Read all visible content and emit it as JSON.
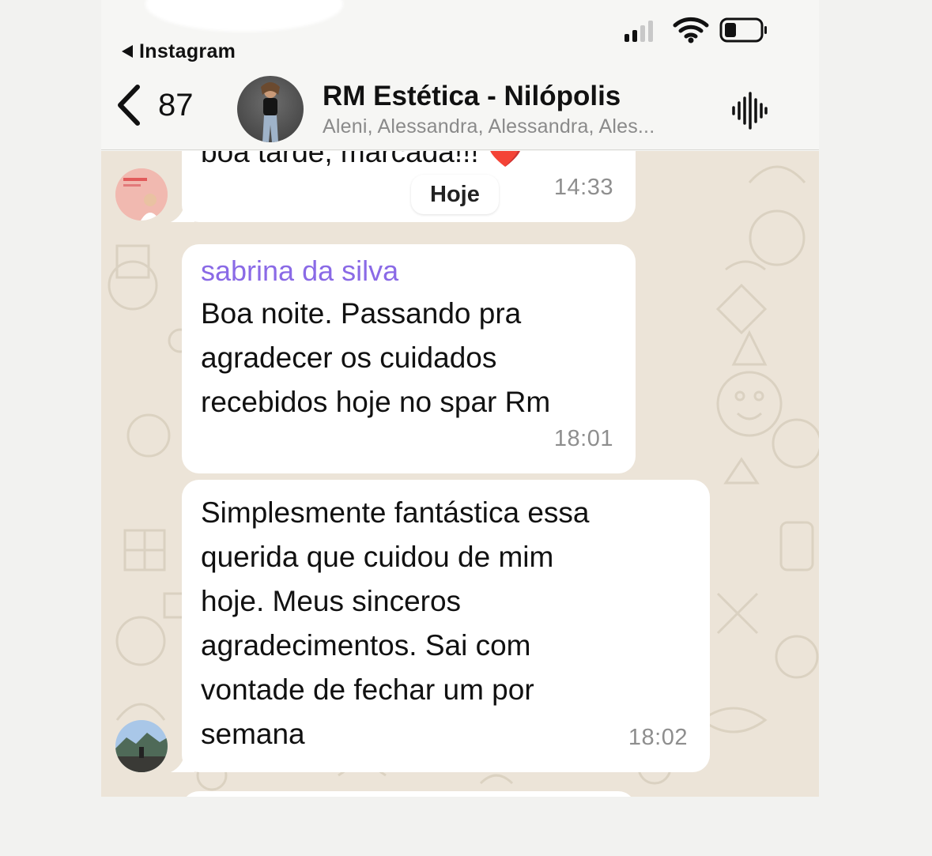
{
  "status_bar": {
    "back_app": "Instagram"
  },
  "header": {
    "unread_count": "87",
    "title": "RM Estética - Nilópolis",
    "subtitle": "Aleni, Alessandra, Alessandra, Ales..."
  },
  "messages": [
    {
      "partial_text": "boa tarde, marcada!!! ",
      "emoji": "❤️",
      "date_pill": "Hoje",
      "time": "14:33"
    },
    {
      "sender": "sabrina da silva",
      "text": "Boa noite. Passando pra\nagradecer os cuidados\nrecebidos hoje no spar Rm",
      "time": "18:01"
    },
    {
      "text": "Simplesmente fantástica essa\nquerida que cuidou de mim\nhoje. Meus sinceros\nagradecimentos. Sai com\nvontade de fechar um por\nsemana",
      "time": "18:02"
    }
  ],
  "colors": {
    "sender_name": "#8a6ae6",
    "chat_background": "#ece4d8",
    "bubble": "#ffffff"
  }
}
